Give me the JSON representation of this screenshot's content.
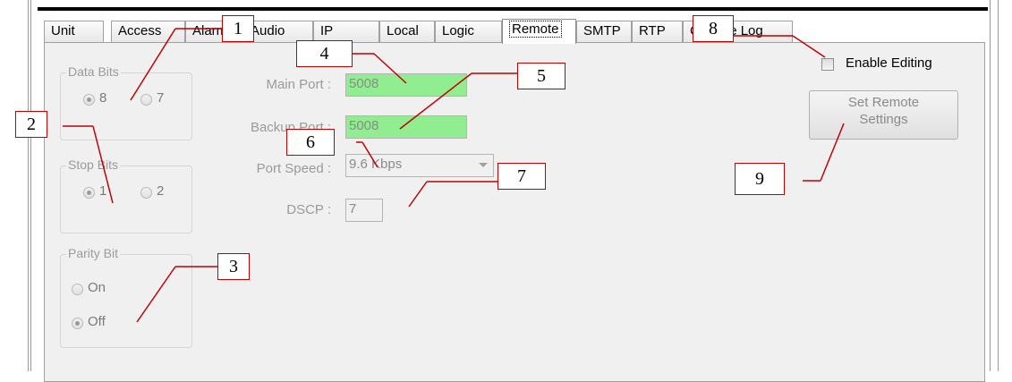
{
  "tabs": [
    {
      "label": "Unit",
      "active": false
    },
    {
      "label": "Access",
      "active": false
    },
    {
      "label": "Alarm",
      "active": false
    },
    {
      "label": "Audio",
      "active": false
    },
    {
      "label": "IP",
      "active": false
    },
    {
      "label": "Local",
      "active": false
    },
    {
      "label": "Logic",
      "active": false
    },
    {
      "label": "Remote",
      "active": true
    },
    {
      "label": "SMTP",
      "active": false
    },
    {
      "label": "RTP",
      "active": false
    },
    {
      "label": "Change Log",
      "active": false
    }
  ],
  "data_bits": {
    "title": "Data Bits",
    "options": [
      "8",
      "7"
    ],
    "selected": "8"
  },
  "stop_bits": {
    "title": "Stop Bits",
    "options": [
      "1",
      "2"
    ],
    "selected": "1"
  },
  "parity_bit": {
    "title": "Parity Bit",
    "options": [
      "On",
      "Off"
    ],
    "selected": "Off"
  },
  "main_port": {
    "label": "Main Port :",
    "value": "5008"
  },
  "backup_port": {
    "label": "Backup Port :",
    "value": "5008"
  },
  "port_speed": {
    "label": "Port Speed :",
    "value": "9.6 Kbps"
  },
  "dscp": {
    "label": "DSCP :",
    "value": "7"
  },
  "enable_editing": {
    "label": "Enable Editing",
    "checked": false
  },
  "set_remote": {
    "line1": "Set Remote",
    "line2": "Settings"
  },
  "callouts": [
    "1",
    "2",
    "3",
    "4",
    "5",
    "6",
    "7",
    "8",
    "9"
  ],
  "colors": {
    "accent": "#c00000",
    "field_green": "#90ee90",
    "panel": "#f0f0f0"
  }
}
